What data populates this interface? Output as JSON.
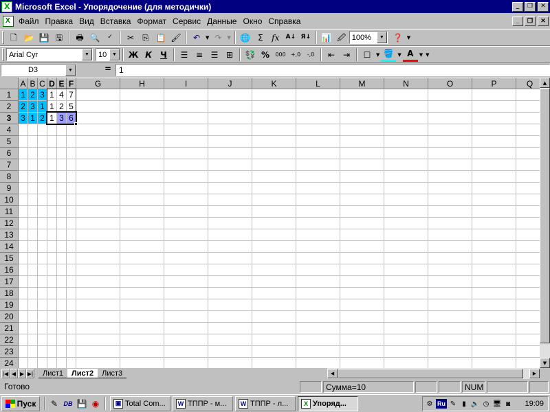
{
  "window": {
    "title": "Microsoft Excel - Упорядочение (для методички)"
  },
  "menu": {
    "items": [
      "Файл",
      "Правка",
      "Вид",
      "Вставка",
      "Формат",
      "Сервис",
      "Данные",
      "Окно",
      "Справка"
    ]
  },
  "toolbar": {
    "zoom": "100%",
    "font_name": "Arial Cyr",
    "font_size": "10",
    "bold": "Ж",
    "italic": "К",
    "underline": "Ч",
    "percent": "%",
    "thousands": "000",
    "sigma": "Σ",
    "fx": "fx"
  },
  "formula_bar": {
    "name_box": "D3",
    "equals": "=",
    "value": "1"
  },
  "sheet": {
    "columns": [
      "A",
      "B",
      "C",
      "D",
      "E",
      "F",
      "G",
      "H",
      "I",
      "J",
      "K",
      "L",
      "M",
      "N",
      "O",
      "P",
      "Q"
    ],
    "selected_columns": [
      "D",
      "E",
      "F"
    ],
    "rows": [
      "1",
      "2",
      "3",
      "4",
      "5",
      "6",
      "7",
      "8",
      "9",
      "10",
      "11",
      "12",
      "13",
      "14",
      "15",
      "16",
      "17",
      "18",
      "19",
      "20",
      "21",
      "22",
      "23",
      "24"
    ],
    "selected_row": "3",
    "cells": [
      [
        "1",
        "2",
        "3",
        "1",
        "4",
        "7"
      ],
      [
        "2",
        "3",
        "1",
        "1",
        "2",
        "5"
      ],
      [
        "3",
        "1",
        "2",
        "1",
        "3",
        "6"
      ]
    ],
    "colors": {
      "cyan": "#00c0ff",
      "lavender": "#a0a0ff"
    }
  },
  "tabs": [
    "Лист1",
    "Лист2",
    "Лист3"
  ],
  "active_tab": "Лист2",
  "status": {
    "ready": "Готово",
    "sum": "Сумма=10",
    "num": "NUM"
  },
  "taskbar": {
    "start": "Пуск",
    "tasks": [
      "Total Com...",
      "ТППР - м...",
      "ТППР - л...",
      "Упоряд..."
    ],
    "clock": "19:09",
    "lang": "Ru"
  }
}
